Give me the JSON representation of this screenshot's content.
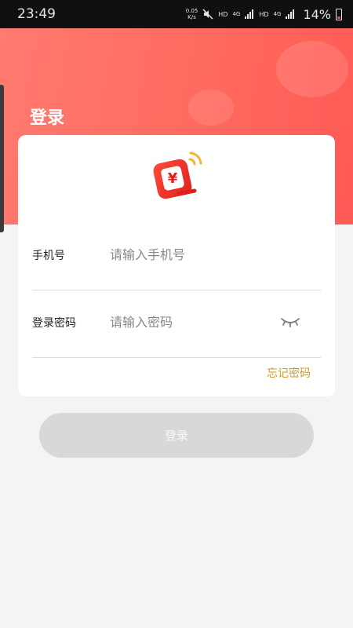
{
  "status_bar": {
    "time": "23:49",
    "net_speed_value": "0.05",
    "net_speed_unit": "K/s",
    "hd_label_1": "HD",
    "gen_label_1": "4G",
    "hd_label_2": "HD",
    "gen_label_2": "4G",
    "battery_percent": "14%",
    "battery_level": 0.14
  },
  "header": {
    "title": "登录"
  },
  "logo": {
    "icon": "wallet-yuan-icon",
    "glyph": "¥"
  },
  "form": {
    "phone": {
      "label": "手机号",
      "value": "",
      "placeholder": "请输入手机号"
    },
    "password": {
      "label": "登录密码",
      "value": "",
      "placeholder": "请输入密码",
      "toggle_icon": "eye-closed-icon"
    },
    "forgot_label": "忘记密码",
    "submit_label": "登录"
  },
  "colors": {
    "header_gradient_start": "#ff7a70",
    "header_gradient_end": "#ff5a55",
    "accent_link": "#d39a2a",
    "button_disabled_bg": "#d8d8d8",
    "page_bg": "#f4f4f4"
  }
}
